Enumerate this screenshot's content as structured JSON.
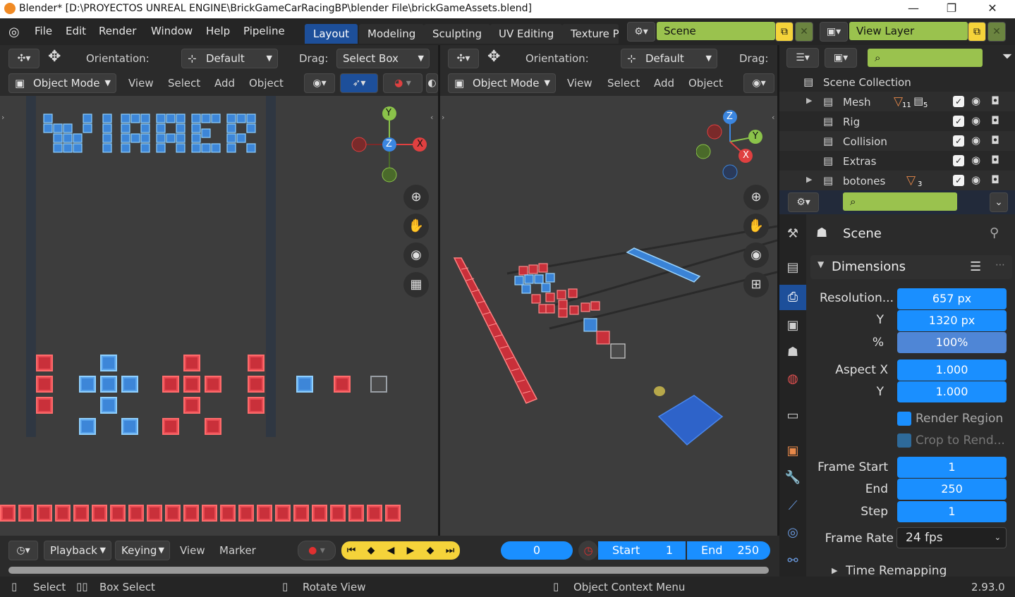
{
  "window": {
    "title": "Blender* [D:\\PROYECTOS UNREAL ENGINE\\BrickGameCarRacingBP\\blender File\\brickGameAssets.blend]",
    "minimize": "—",
    "maximize": "❐",
    "close": "✕"
  },
  "menu": [
    "File",
    "Edit",
    "Render",
    "Window",
    "Help",
    "Pipeline"
  ],
  "workspaces": [
    {
      "label": "Layout",
      "active": true
    },
    {
      "label": "Modeling",
      "active": false
    },
    {
      "label": "Sculpting",
      "active": false
    },
    {
      "label": "UV Editing",
      "active": false
    },
    {
      "label": "Texture P",
      "active": false
    }
  ],
  "scene_field": "Scene",
  "view_layer_field": "View Layer",
  "left_viewport": {
    "orientation_label": "Orientation:",
    "orientation_value": "Default",
    "drag_label": "Drag:",
    "drag_value": "Select Box",
    "mode": "Object Mode",
    "menu": [
      "View",
      "Select",
      "Add",
      "Object"
    ],
    "title_text": "WINNER",
    "gizmo": {
      "y": "Y",
      "z": "Z",
      "x": "X"
    }
  },
  "right_viewport": {
    "orientation_label": "Orientation:",
    "orientation_value": "Default",
    "drag_label": "Drag:",
    "mode": "Object Mode",
    "menu": [
      "View",
      "Select",
      "Add",
      "Object"
    ],
    "gizmo": {
      "z": "Z",
      "y": "Y",
      "x": "X"
    }
  },
  "outliner": {
    "root": "Scene Collection",
    "items": [
      {
        "name": "Mesh",
        "badge1": "11",
        "badge2": "5",
        "expandable": true
      },
      {
        "name": "Rig",
        "expandable": false
      },
      {
        "name": "Collision",
        "expandable": false
      },
      {
        "name": "Extras",
        "expandable": false
      },
      {
        "name": "botones",
        "badge1": "3",
        "expandable": true
      }
    ]
  },
  "properties": {
    "context": "Scene",
    "panel": "Dimensions",
    "resolution_label": "Resolution...",
    "res_x": "657 px",
    "y_label": "Y",
    "res_y": "1320 px",
    "pct_label": "%",
    "pct": "100%",
    "aspect_x_label": "Aspect X",
    "aspect_x": "1.000",
    "aspect_y_label": "Y",
    "aspect_y": "1.000",
    "render_region": "Render Region",
    "crop": "Crop to Rend...",
    "frame_start_label": "Frame Start",
    "frame_start": "1",
    "end_label": "End",
    "frame_end": "250",
    "step_label": "Step",
    "step": "1",
    "frame_rate_label": "Frame Rate",
    "frame_rate": "24 fps",
    "time_remapping": "Time Remapping"
  },
  "timeline": {
    "playback": "Playback",
    "keying": "Keying",
    "view": "View",
    "marker": "Marker",
    "current_frame": "0",
    "start_label": "Start",
    "start": "1",
    "end_label": "End",
    "end": "250"
  },
  "status": {
    "select": "Select",
    "box_select": "Box Select",
    "rotate_view": "Rotate View",
    "context_menu": "Object Context Menu",
    "version": "2.93.0"
  }
}
